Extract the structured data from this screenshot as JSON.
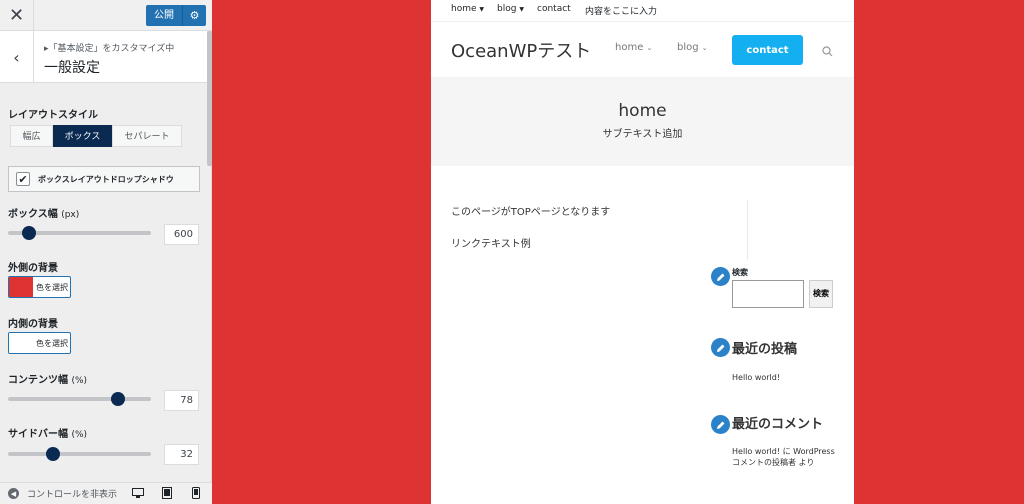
{
  "customizer": {
    "close_label": "✕",
    "publish_label": "公開",
    "breadcrumb": "▸「基本設定」をカスタマイズ中",
    "section_title": "一般設定",
    "layout_style": {
      "label": "レイアウトスタイル",
      "options": [
        "幅広",
        "ボックス",
        "セパレート"
      ],
      "selected": "ボックス"
    },
    "box_shadow": {
      "label": "ボックスレイアウトドロップシャドウ",
      "checked": true
    },
    "box_width": {
      "label": "ボックス幅",
      "unit": "(px)",
      "value": "600",
      "min": 0,
      "max": 4000,
      "fraction": 0.15
    },
    "outer_bg": {
      "label": "外側の背景",
      "button": "色を選択",
      "color": "#dd3333"
    },
    "inner_bg": {
      "label": "内側の背景",
      "button": "色を選択",
      "color": "#ffffff"
    },
    "content_width": {
      "label": "コンテンツ幅",
      "unit": "(%)",
      "value": "78",
      "fraction": 0.78
    },
    "sidebar_width": {
      "label": "サイドバー幅",
      "unit": "(%)",
      "value": "32",
      "fraction": 0.32
    },
    "footer": {
      "hide_controls": "コントロールを非表示"
    }
  },
  "site": {
    "topnav": [
      "home",
      "blog",
      "contact",
      "内容をここに入力"
    ],
    "title": "OceanWPテスト",
    "menu": [
      "home",
      "blog"
    ],
    "contact_button": "contact",
    "hero_title": "home",
    "hero_subtitle": "サブテキスト追加",
    "body_lines": [
      "このページがTOPページとなります",
      "リンクテキスト例"
    ],
    "widgets": {
      "search_title": "検索",
      "search_button": "検索",
      "recent_posts_title": "最近の投稿",
      "recent_post": "Hello world!",
      "recent_comments_title": "最近のコメント",
      "recent_comment": "Hello world! に WordPress コメントの投稿者 より"
    }
  },
  "colors": {
    "outer_bg": "#dd3333",
    "accent": "#13aff0",
    "knob": "#0b2a52",
    "wp_blue": "#2271b1"
  }
}
